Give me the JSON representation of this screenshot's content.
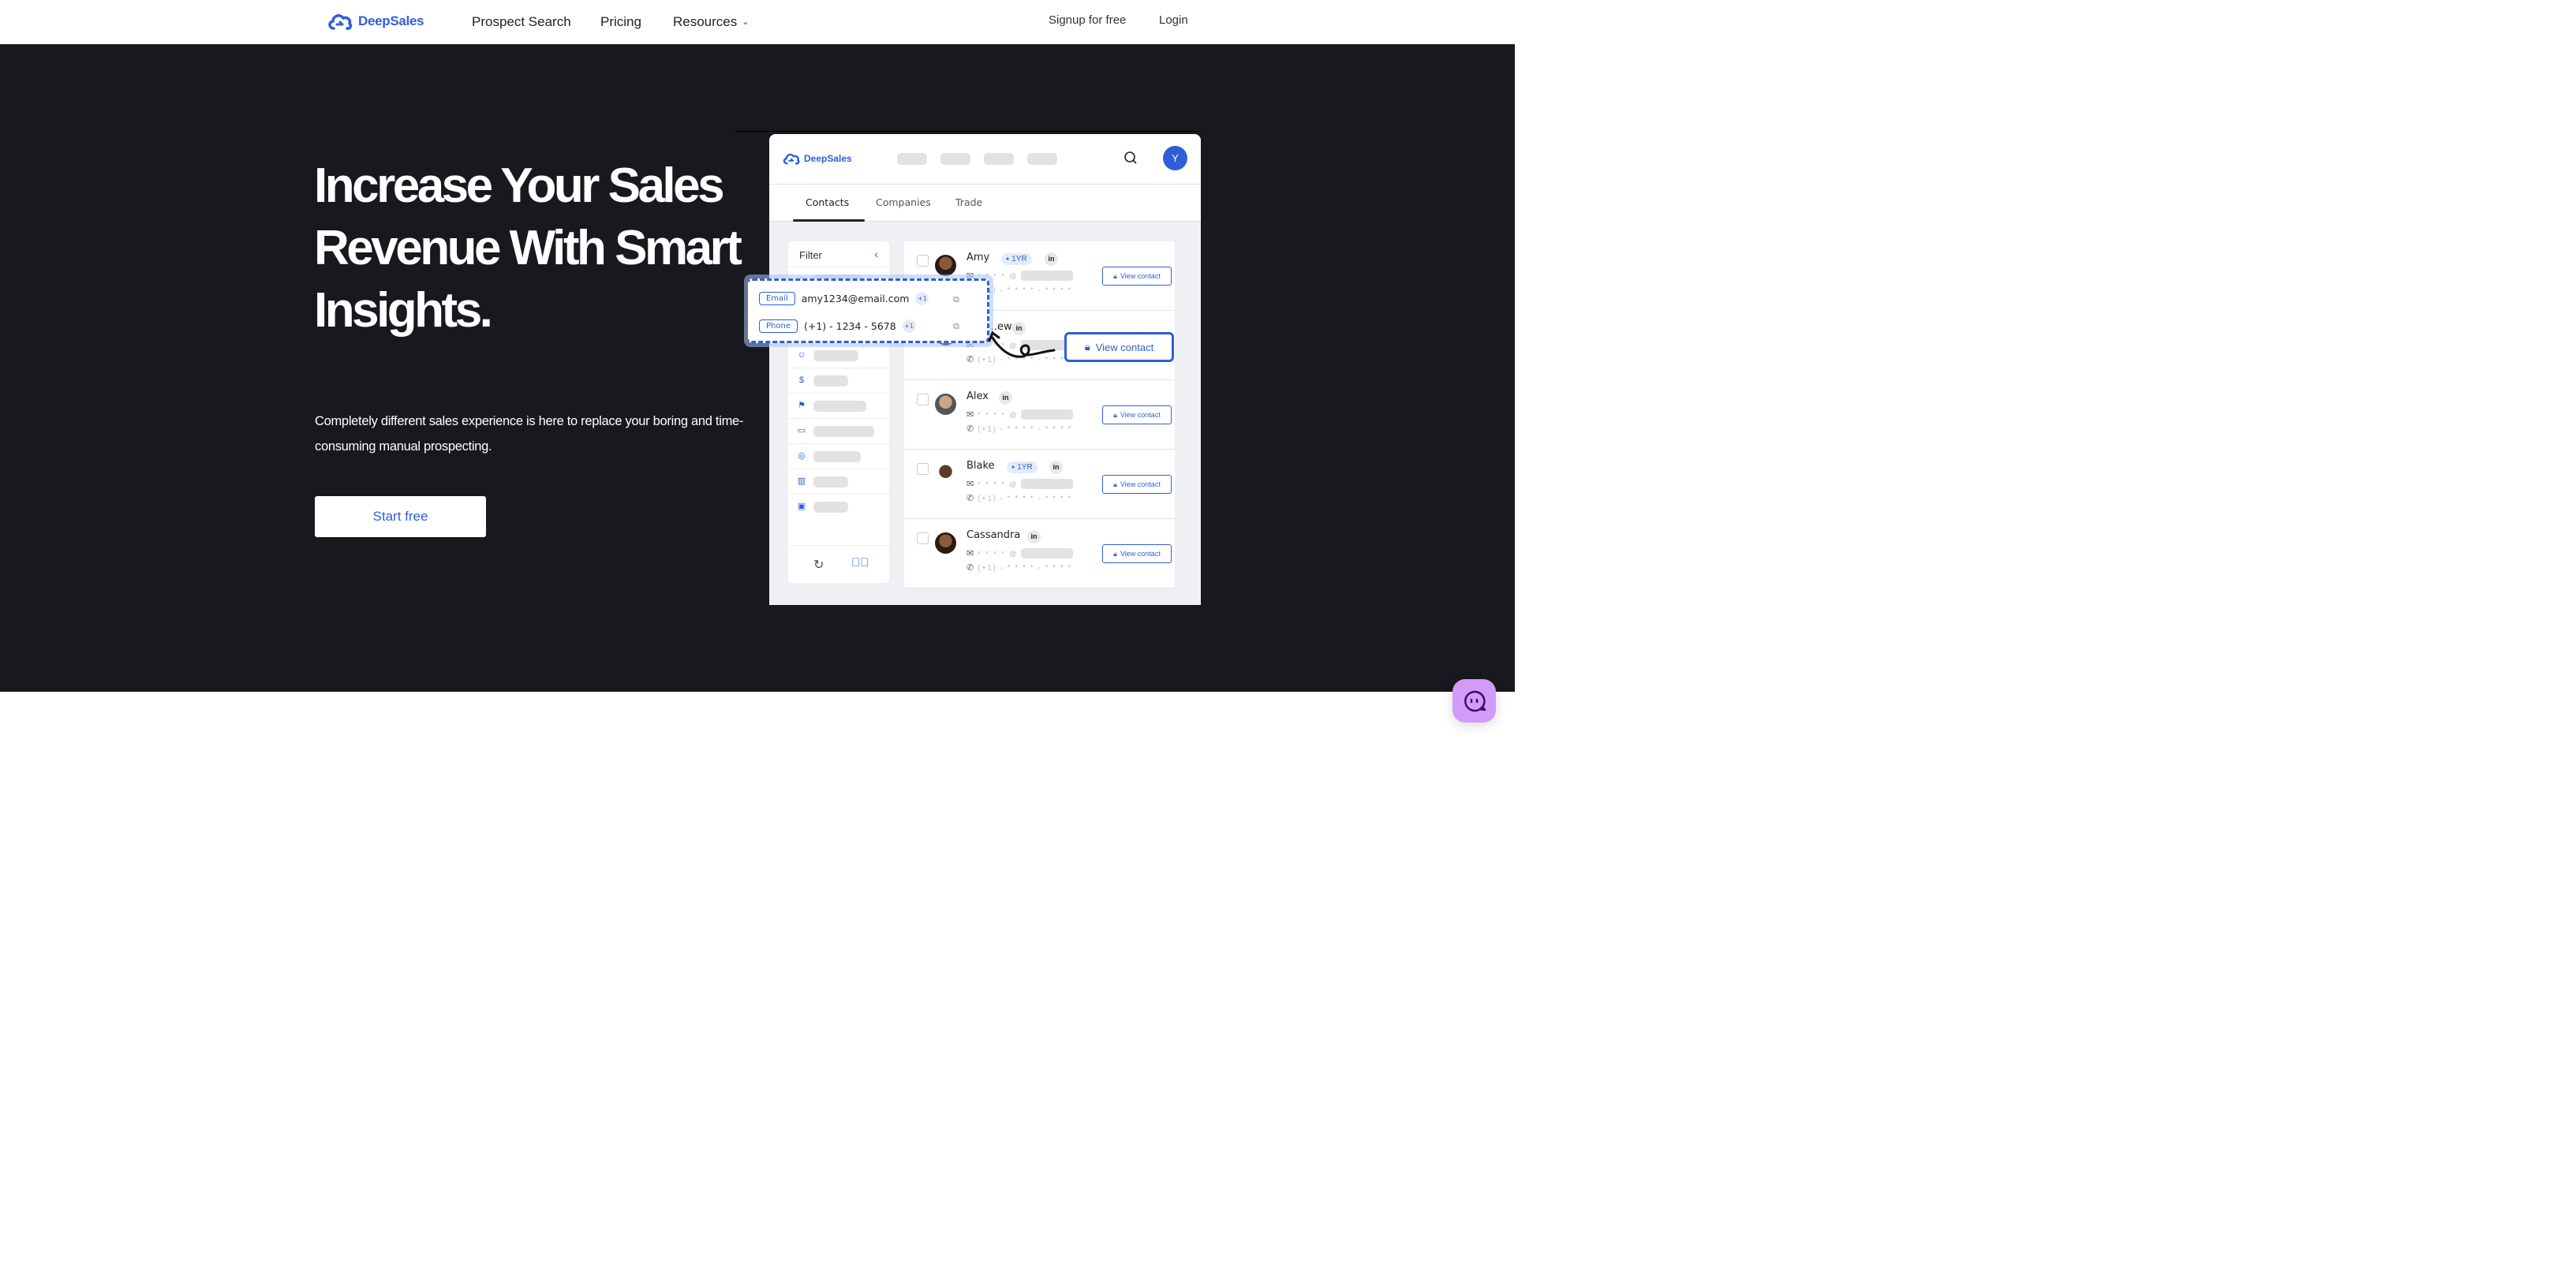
{
  "nav": {
    "brand": "DeepSales",
    "links": [
      "Prospect Search",
      "Pricing",
      "Resources"
    ],
    "signup": "Signup for free",
    "login": "Login"
  },
  "hero": {
    "headline": "Increase Your Sales Revenue With Smart Insights.",
    "subtext": "Completely different sales experience is here to replace your boring and time-consuming manual prospecting.",
    "cta": "Start free"
  },
  "mockup": {
    "brand": "DeepSales",
    "avatar_initial": "Y",
    "tabs": [
      "Contacts",
      "Companies",
      "Trade"
    ],
    "active_tab": "Contacts",
    "filter_title": "Filter",
    "contacts": [
      {
        "name": "Amy",
        "tag": "1YR",
        "linkedin": "in",
        "masked_email": "* * * * @",
        "masked_phone": "(+1) - * * * * - * * * *",
        "button": "View contact"
      },
      {
        "name": "…ew",
        "tag": "",
        "linkedin": "in",
        "masked_email": "* * * * @",
        "masked_phone": "(+1) - * * * * - * * * *",
        "button": "View contact"
      },
      {
        "name": "Alex",
        "tag": "",
        "linkedin": "in",
        "masked_email": "* * * * @",
        "masked_phone": "(+1) - * * * * - * * * *",
        "button": "View contact"
      },
      {
        "name": "Blake",
        "tag": "1YR",
        "linkedin": "in",
        "masked_email": "* * * * @",
        "masked_phone": "(+1) - * * * * - * * * *",
        "button": "View contact"
      },
      {
        "name": "Cassandra",
        "tag": "",
        "linkedin": "in",
        "masked_email": "* * * * @",
        "masked_phone": "(+1) - * * * * - * * * *",
        "button": "View contact"
      }
    ],
    "popup": {
      "email_label": "Email",
      "email": "amy1234@email.com",
      "email_extra": "+1",
      "phone_label": "Phone",
      "phone": "(+1) - 1234 - 5678",
      "phone_extra": "+1"
    }
  },
  "colors": {
    "brand": "#2f5fd6",
    "hero_bg": "#18181f",
    "chat_bg": "#d29bf8"
  },
  "icons": {
    "chat": "chat-bubble-icon",
    "search": "search-icon",
    "lock": "lock-icon"
  }
}
